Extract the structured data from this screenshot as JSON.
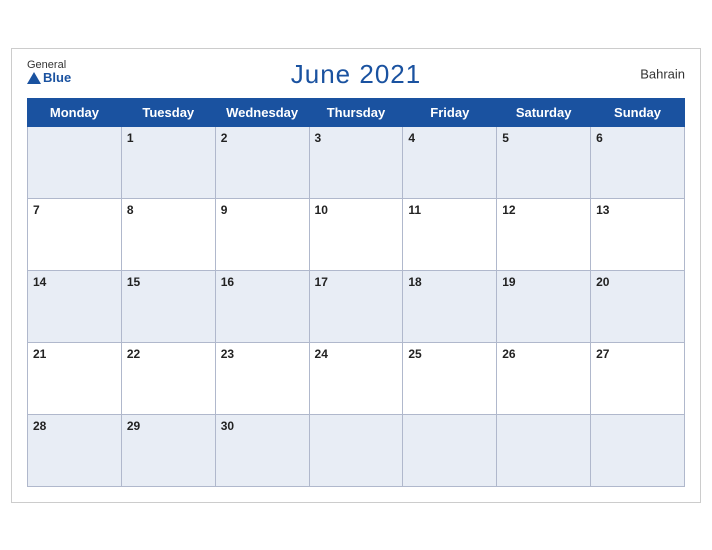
{
  "header": {
    "title": "June 2021",
    "country": "Bahrain",
    "logo_general": "General",
    "logo_blue": "Blue"
  },
  "days_of_week": [
    "Monday",
    "Tuesday",
    "Wednesday",
    "Thursday",
    "Friday",
    "Saturday",
    "Sunday"
  ],
  "weeks": [
    [
      null,
      1,
      2,
      3,
      4,
      5,
      6
    ],
    [
      7,
      8,
      9,
      10,
      11,
      12,
      13
    ],
    [
      14,
      15,
      16,
      17,
      18,
      19,
      20
    ],
    [
      21,
      22,
      23,
      24,
      25,
      26,
      27
    ],
    [
      28,
      29,
      30,
      null,
      null,
      null,
      null
    ]
  ]
}
